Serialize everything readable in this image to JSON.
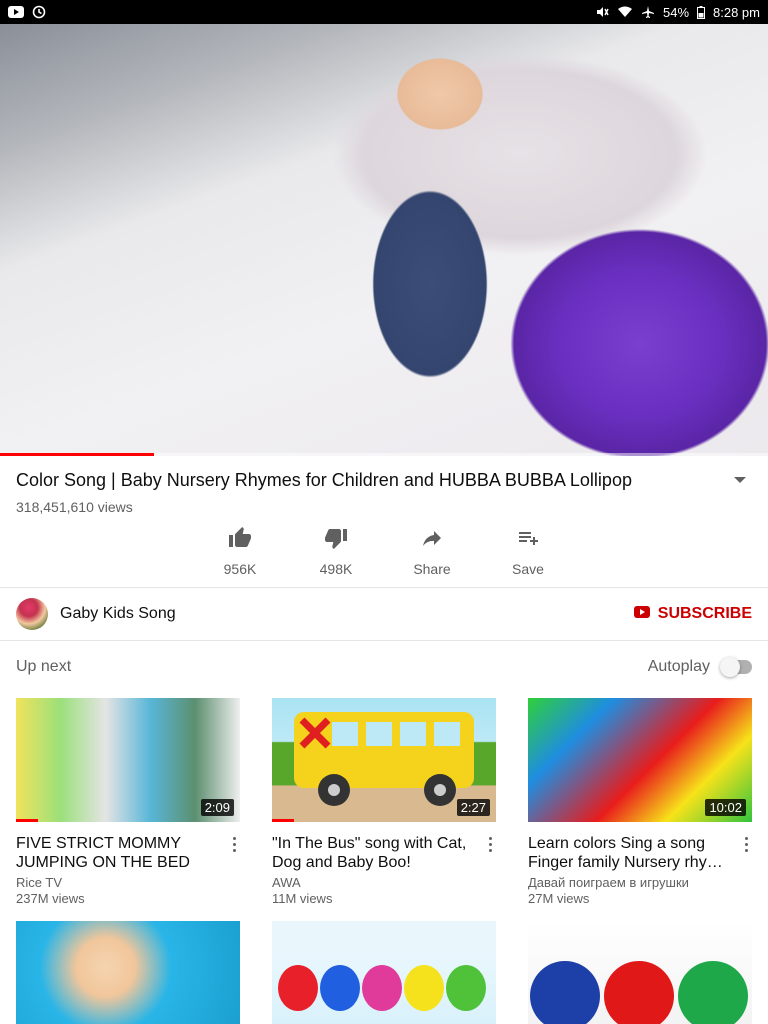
{
  "status_bar": {
    "battery": "54%",
    "time": "8:28 pm"
  },
  "player": {
    "progress_fraction": 0.2
  },
  "video": {
    "title": "Color Song | Baby Nursery Rhymes for Children and HUBBA BUBBA Lollipop",
    "views": "318,451,610 views"
  },
  "actions": {
    "like": "956K",
    "dislike": "498K",
    "share": "Share",
    "save": "Save"
  },
  "channel": {
    "name": "Gaby Kids Song",
    "subscribe": "SUBSCRIBE"
  },
  "up_next": {
    "label": "Up next",
    "autoplay": "Autoplay",
    "autoplay_on": false
  },
  "cards": [
    {
      "title": "FIVE STRICT MOMMY JUMPING ON THE BED S…",
      "channel": "Rice TV",
      "views": "237M views",
      "duration": "2:09",
      "progress_fraction": 0.1
    },
    {
      "title": "\"In The Bus\" song with Cat, Dog and Baby Boo!",
      "channel": "AWA",
      "views": "11M views",
      "duration": "2:27",
      "progress_fraction": 0.1
    },
    {
      "title": "Learn colors Sing a song Finger family Nursery rhy…",
      "channel": "Давай поиграем в игрушки",
      "views": "27M views",
      "duration": "10:02",
      "progress_fraction": 0
    }
  ],
  "colors": {
    "accent": "#ff0000",
    "subscribe": "#cc0000",
    "secondary_text": "#606060"
  },
  "icons": [
    "youtube-icon",
    "sync-icon",
    "mute-icon",
    "wifi-icon",
    "airplane-icon",
    "battery-icon",
    "dropdown-icon",
    "thumb-up-icon",
    "thumb-down-icon",
    "share-icon",
    "playlist-add-icon",
    "youtube-logo-icon",
    "more-vert-icon"
  ]
}
